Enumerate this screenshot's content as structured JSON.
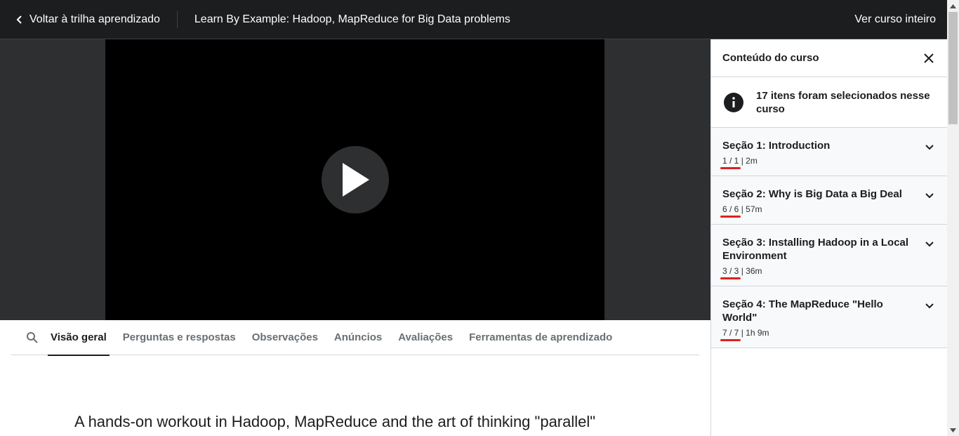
{
  "header": {
    "back_label": "Voltar à trilha aprendizado",
    "course_title": "Learn By Example: Hadoop, MapReduce for Big Data problems",
    "full_course_label": "Ver curso inteiro"
  },
  "tabs": [
    {
      "label": "Visão geral",
      "active": true
    },
    {
      "label": "Perguntas e respostas"
    },
    {
      "label": "Observações"
    },
    {
      "label": "Anúncios"
    },
    {
      "label": "Avaliações"
    },
    {
      "label": "Ferramentas de aprendizado"
    }
  ],
  "overview": {
    "heading": "A hands-on workout in Hadoop, MapReduce and the art of thinking \"parallel\""
  },
  "sidebar": {
    "title": "Conteúdo do curso",
    "info_text": "17 itens foram selecionados nesse curso",
    "sections": [
      {
        "title": "Seção 1: Introduction",
        "count": "1 / 1",
        "duration": "2m"
      },
      {
        "title": "Seção 2: Why is Big Data a Big Deal",
        "count": "6 / 6",
        "duration": "57m"
      },
      {
        "title": "Seção 3: Installing Hadoop in a Local Environment",
        "count": "3 / 3",
        "duration": "36m"
      },
      {
        "title": "Seção 4: The MapReduce \"Hello World\"",
        "count": "7 / 7",
        "duration": "1h 9m"
      }
    ]
  },
  "colors": {
    "topbar_bg": "#1c1d1f",
    "video_bg": "#000000",
    "highlight_underline": "#e02020"
  }
}
